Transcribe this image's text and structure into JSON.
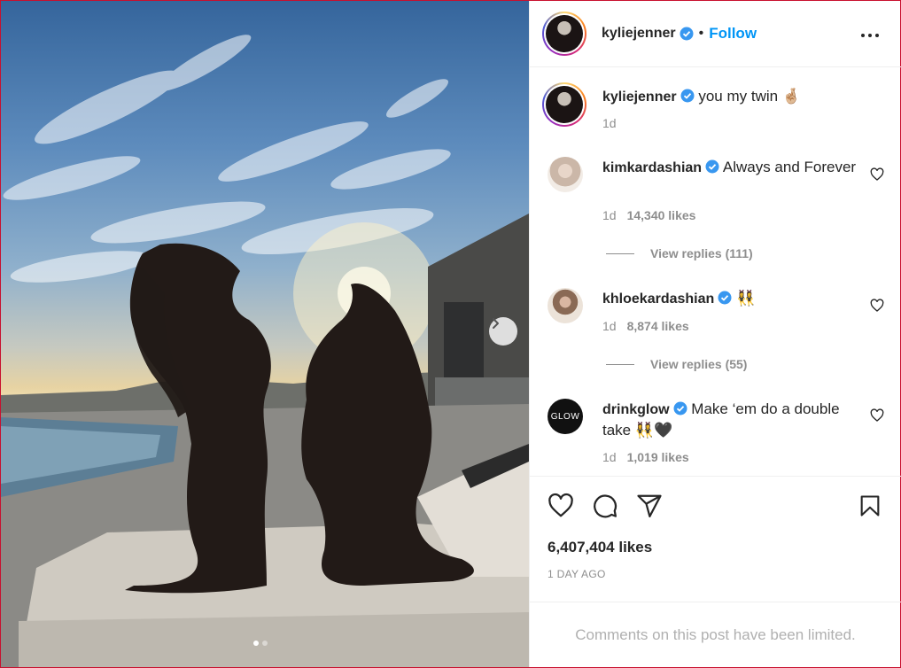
{
  "post": {
    "author": "kyliejenner",
    "separator": "•",
    "follow_label": "Follow",
    "caption_text": "you my twin 🤞🏼",
    "caption_time": "1d",
    "likes": "6,407,404 likes",
    "posted": "1 DAY AGO",
    "comments_notice": "Comments on this post have been limited."
  },
  "comments": [
    {
      "user": "kimkardashian",
      "text": "Always and Forever",
      "time": "1d",
      "likes": "14,340 likes",
      "replies": "View replies (111)"
    },
    {
      "user": "khloekardashian",
      "text": "👯‍♀️",
      "time": "1d",
      "likes": "8,874 likes",
      "replies": "View replies (55)"
    },
    {
      "user": "drinkglow",
      "text": "Make ‘em do a double take 👯‍♀️🖤",
      "time": "1d",
      "likes": "1,019 likes",
      "avatar_text": "GLOW"
    }
  ],
  "carousel": {
    "current": 1,
    "total": 2
  },
  "colors": {
    "accent": "#0095f6",
    "verified": "#3897f0",
    "muted": "#8e8e8e"
  },
  "icons": [
    "verified-icon",
    "more-options-icon",
    "heart-icon",
    "comment-icon",
    "share-icon",
    "save-icon",
    "chevron-right-icon"
  ]
}
